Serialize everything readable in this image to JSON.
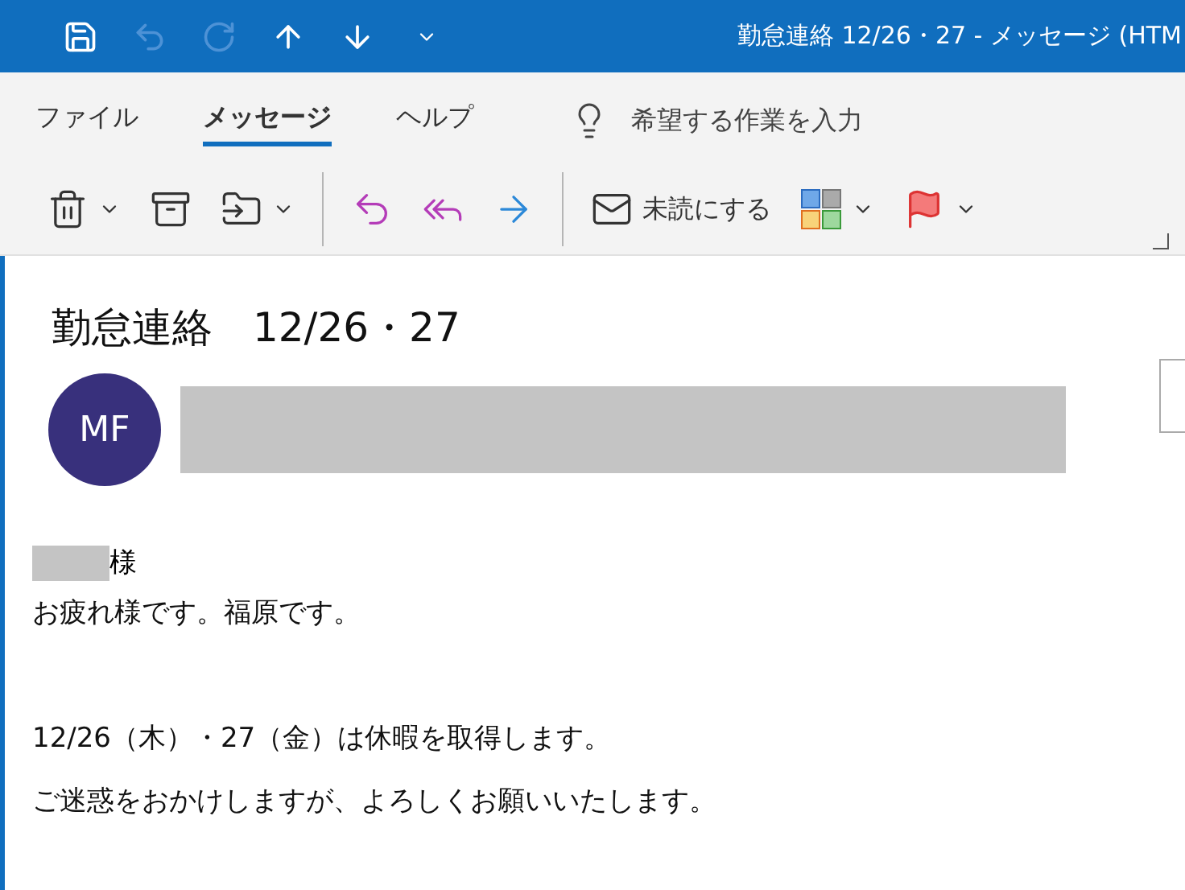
{
  "title_bar": {
    "quick_access": [
      {
        "kind": "save",
        "disabled": false
      },
      {
        "kind": "undo",
        "disabled": true
      },
      {
        "kind": "redo",
        "disabled": true
      },
      {
        "kind": "up",
        "disabled": false
      },
      {
        "kind": "down",
        "disabled": false
      },
      {
        "kind": "customize",
        "disabled": false
      }
    ],
    "title": "勤怠連絡  12/26・27  -  メッセージ (HTM"
  },
  "ribbon": {
    "tabs": [
      {
        "label": "ファイル",
        "selected": false
      },
      {
        "label": "メッセージ",
        "selected": true
      },
      {
        "label": "ヘルプ",
        "selected": false
      }
    ],
    "tell_me": {
      "placeholder": "希望する作業を入力"
    },
    "toolbar": [
      {
        "kind": "delete",
        "has_menu": true
      },
      {
        "kind": "archive",
        "has_menu": false
      },
      {
        "kind": "move",
        "has_menu": true
      },
      {
        "kind": "separator"
      },
      {
        "kind": "reply",
        "has_menu": false
      },
      {
        "kind": "reply_all",
        "has_menu": false
      },
      {
        "kind": "forward",
        "has_menu": false
      },
      {
        "kind": "separator"
      },
      {
        "kind": "unread",
        "label": "未読にする",
        "has_menu": false
      },
      {
        "kind": "categorize",
        "has_menu": true
      },
      {
        "kind": "flag",
        "has_menu": true
      }
    ]
  },
  "message": {
    "subject": "勤怠連絡　12/26・27",
    "avatar": {
      "initials": "MF"
    },
    "sender": {
      "redacted": true
    },
    "greeting": {
      "name_redacted": true,
      "suffix": "様"
    },
    "body": [
      {
        "lines": [
          "お疲れ様です。福原です。"
        ]
      },
      {
        "lines": [
          "12/26（木）・27（金）は休暇を取得します。",
          "ご迷惑をおかけしますが、よろしくお願いいたします。"
        ]
      }
    ]
  }
}
